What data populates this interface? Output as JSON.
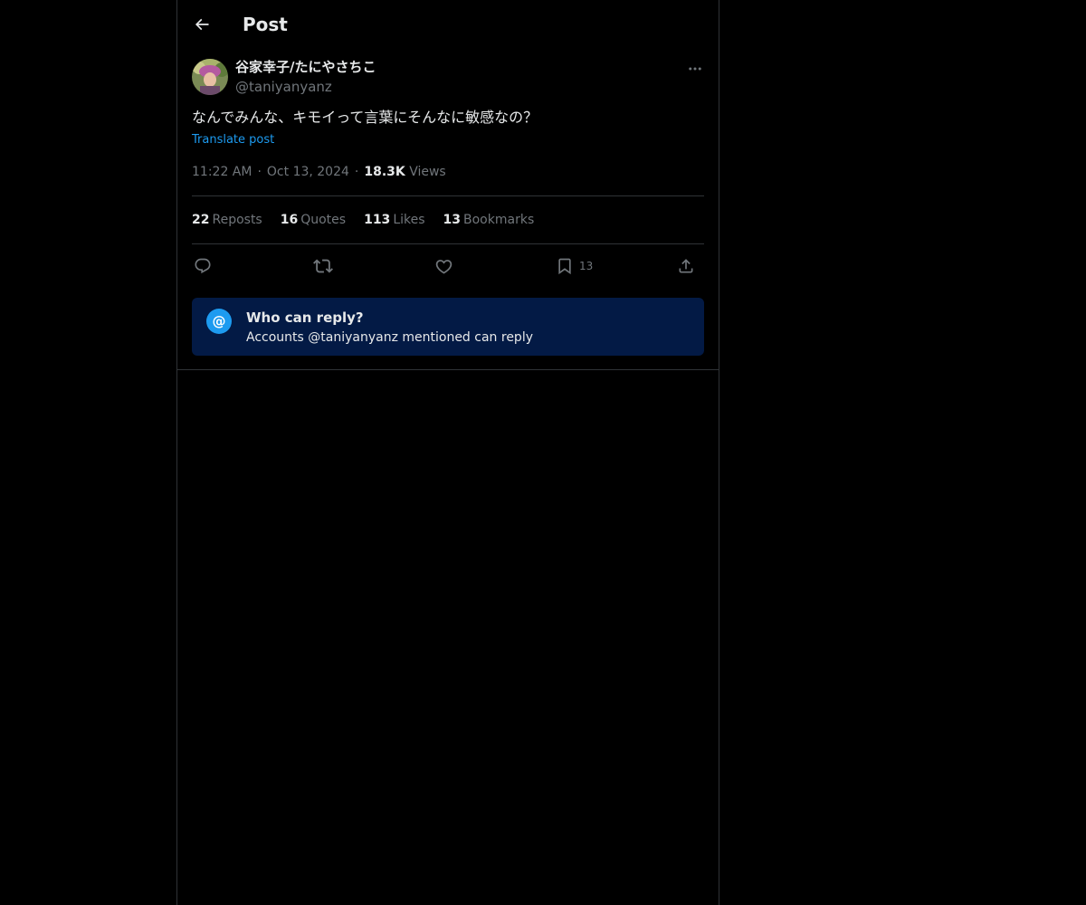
{
  "header": {
    "title": "Post",
    "back_icon": "arrow-left-icon"
  },
  "post": {
    "author": {
      "display_name": "谷家幸子/たにやさちこ",
      "handle": "@taniyanyanz"
    },
    "text": "なんでみんな、キモイって言葉にそんなに敏感なの？",
    "translate_label": "Translate post",
    "time": "11:22 AM",
    "date": "Oct 13, 2024",
    "views_count": "18.3K",
    "views_label": "Views"
  },
  "stats": {
    "reposts": {
      "count": "22",
      "label": "Reposts"
    },
    "quotes": {
      "count": "16",
      "label": "Quotes"
    },
    "likes": {
      "count": "113",
      "label": "Likes"
    },
    "bookmarks": {
      "count": "13",
      "label": "Bookmarks"
    }
  },
  "actions": {
    "bookmark_count": "13",
    "icons": [
      "reply-icon",
      "repost-icon",
      "like-icon",
      "bookmark-icon",
      "share-icon"
    ]
  },
  "reply_restriction": {
    "title": "Who can reply?",
    "subtitle": "Accounts @taniyanyanz mentioned can reply",
    "icon_glyph": "@"
  },
  "colors": {
    "background": "#000000",
    "accent": "#1d9bf0",
    "muted_text": "#71767b",
    "reply_box": "#031a45"
  }
}
